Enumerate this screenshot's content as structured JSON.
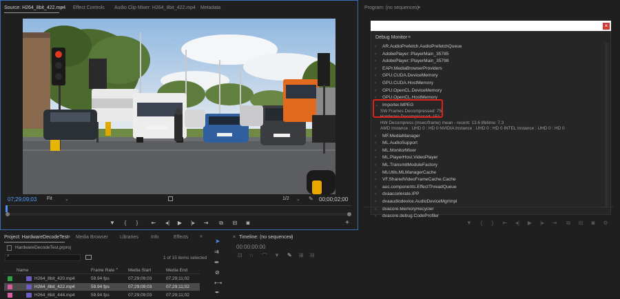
{
  "source": {
    "tabs": [
      {
        "label": "Source: H264_8bit_422.mp4",
        "active": true
      },
      {
        "label": "Effect Controls"
      },
      {
        "label": "Audio Clip Mixer: H264_8bit_422.mp4"
      },
      {
        "label": "Metadata"
      }
    ],
    "menu_glyph": "≡",
    "timecode": "07;29;09;03",
    "fit": "Fit",
    "resolution": "1/2",
    "duration": "00;00;02;00",
    "add": "+"
  },
  "program": {
    "title": "Program: (no sequences)",
    "menu_glyph": "≡",
    "debug_monitor": {
      "title": "Debug Monitor",
      "close": "×",
      "items_before": [
        "AR.AudioPrefetch.AudioPrefetchQueue",
        "AdobePlayer::PlayerMain_35785",
        "AdobePlayer::PlayerMain_35798",
        "EAPr.MediaBrowserProviders",
        "GPU.CUDA.DeviceMemory",
        "GPU.CUDA.HostMemory",
        "GPU.OpenCL.DeviceMemory",
        "GPU.OpenCL.HostMemory"
      ],
      "expanded": {
        "label": "Importer.MPEG",
        "lines": [
          "SW Frames Decompressed: 75",
          "Hardware Decompressed: 151",
          "HW Decompress (msec/frame) mean - recent:  13.6 lifetime:  7.3",
          "AMD Instance : UHD    0 : HD    0     NVIDIA Instance : UHD    0 : HD    0      INTEL Instance : UHD    0 : HD    0"
        ]
      },
      "items_after": [
        "MF.MediaManager",
        "ML.AudioSupport",
        "ML.MonitorMixer",
        "ML.PlayerHost.VideoPlayer",
        "ML.TransmitModuleFactory",
        "MLUtils.MLManagerCache",
        "VF.SharedVideoFrameCache.Cache",
        "auc.components.EffectThreadQueue",
        "dvaaccelerate.IPP",
        "dvaaudiodevice.AudioDeviceMgrImpl",
        "dvacore.MemoryRecycler",
        "dvacore.debug.CodeProfiler"
      ],
      "highlight_color": "#e0221c"
    }
  },
  "project": {
    "tabs": [
      {
        "label": "Project: HardwareDecodeTest",
        "active": true
      },
      {
        "label": "Media Browser"
      },
      {
        "label": "Libraries"
      },
      {
        "label": "Info"
      },
      {
        "label": "Effects"
      }
    ],
    "more": "»",
    "file": "HardwareDecodeTest.prproj",
    "search_placeholder": "",
    "count": "1 of 15 items selected",
    "columns": [
      "Name",
      "Frame Rate",
      "Media Start",
      "Media End"
    ],
    "rows": [
      {
        "name": "H264_8bit_420.mp4",
        "rate": "59.94 fps",
        "start": "07;29;09;03",
        "end": "07;29;11;02",
        "color": "#2ea043",
        "selected": false
      },
      {
        "name": "H264_8bit_422.mp4",
        "rate": "59.94 fps",
        "start": "07;29;09;03",
        "end": "07;29;11;02",
        "color": "#d85ca0",
        "selected": true
      },
      {
        "name": "H264_8bit_444.mp4",
        "rate": "59.94 fps",
        "start": "07;29;09;03",
        "end": "07;29;11;02",
        "color": "#d85ca0",
        "selected": false
      }
    ]
  },
  "timeline": {
    "title": "Timeline: (no sequences)",
    "timecode": "00:00:00:00"
  }
}
